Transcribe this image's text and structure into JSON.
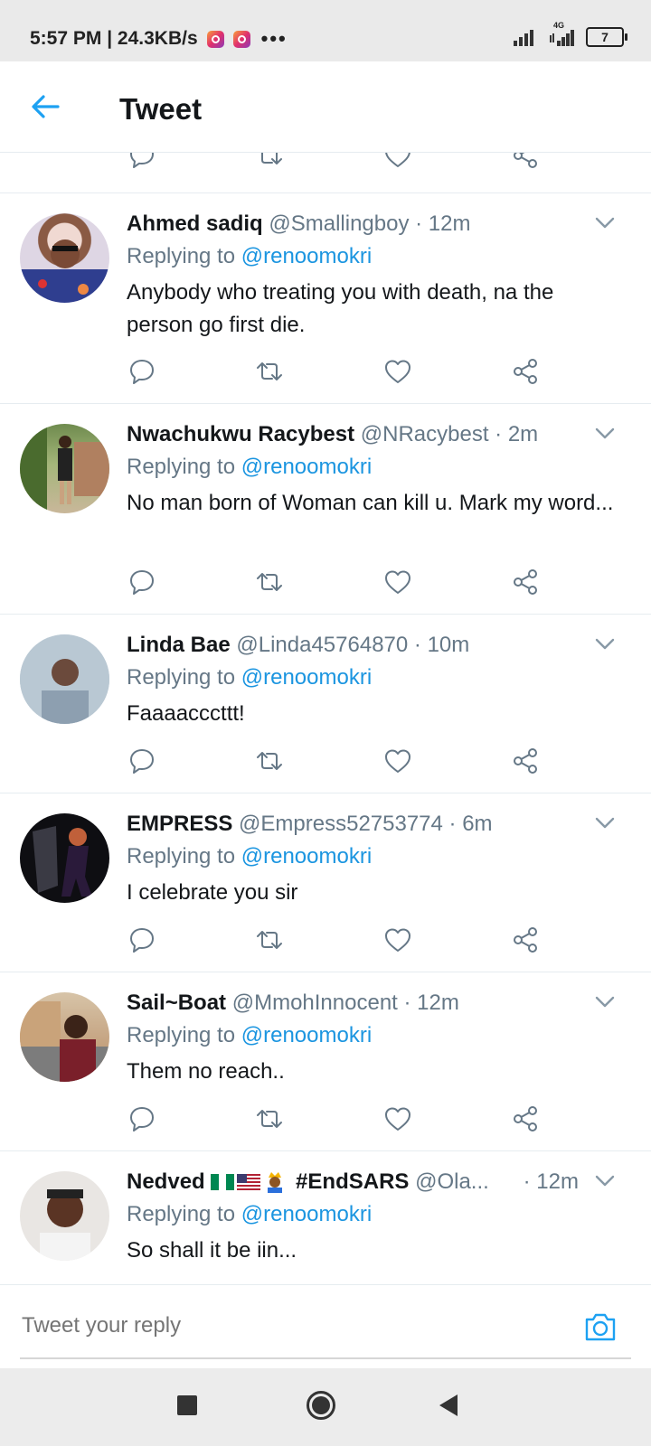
{
  "status_bar": {
    "time_speed": "5:57 PM | 24.3KB/s",
    "overflow_dots": "•••",
    "network_label": "4G",
    "battery": "7"
  },
  "app_bar": {
    "title": "Tweet"
  },
  "tweets": [
    {
      "name": "Ahmed sadiq",
      "handle": "@Smallingboy · 12m",
      "replying_prefix": "Replying to ",
      "replying_to": "@renoomokri",
      "text": "Anybody who treating you with death, na the person go first die."
    },
    {
      "name": "Nwachukwu Racybest",
      "handle": "@NRacybest · 2m",
      "replying_prefix": "Replying to ",
      "replying_to": "@renoomokri",
      "text": "No man born of Woman can kill u. Mark my word..."
    },
    {
      "name": "Linda Bae",
      "handle": "@Linda45764870 · 10m",
      "replying_prefix": "Replying to ",
      "replying_to": "@renoomokri",
      "text": "Faaaacccttt!"
    },
    {
      "name": "EMPRESS",
      "handle": "@Empress52753774 · 6m",
      "replying_prefix": "Replying to ",
      "replying_to": "@renoomokri",
      "text": "I celebrate you sir"
    },
    {
      "name": "Sail~Boat",
      "handle": "@MmohInnocent · 12m",
      "replying_prefix": "Replying to ",
      "replying_to": "@renoomokri",
      "text": "Them no reach.."
    },
    {
      "name": "Nedved",
      "name_suffix": "#EndSARS",
      "handle": "@Ola...",
      "time": "· 12m",
      "replying_prefix": "Replying to ",
      "replying_to": "@renoomokri",
      "text": "So shall it be iin..."
    }
  ],
  "reply_bar": {
    "placeholder": "Tweet your reply"
  },
  "colors": {
    "accent": "#1b95e0",
    "secondary_text": "#657786",
    "primary_text": "#14171a",
    "divider": "#e6ecf0"
  },
  "icons": {
    "back": "arrow-left-icon",
    "reply": "comment-icon",
    "retweet": "retweet-icon",
    "like": "heart-icon",
    "share": "share-icon",
    "caret": "chevron-down-icon",
    "camera": "camera-icon"
  }
}
